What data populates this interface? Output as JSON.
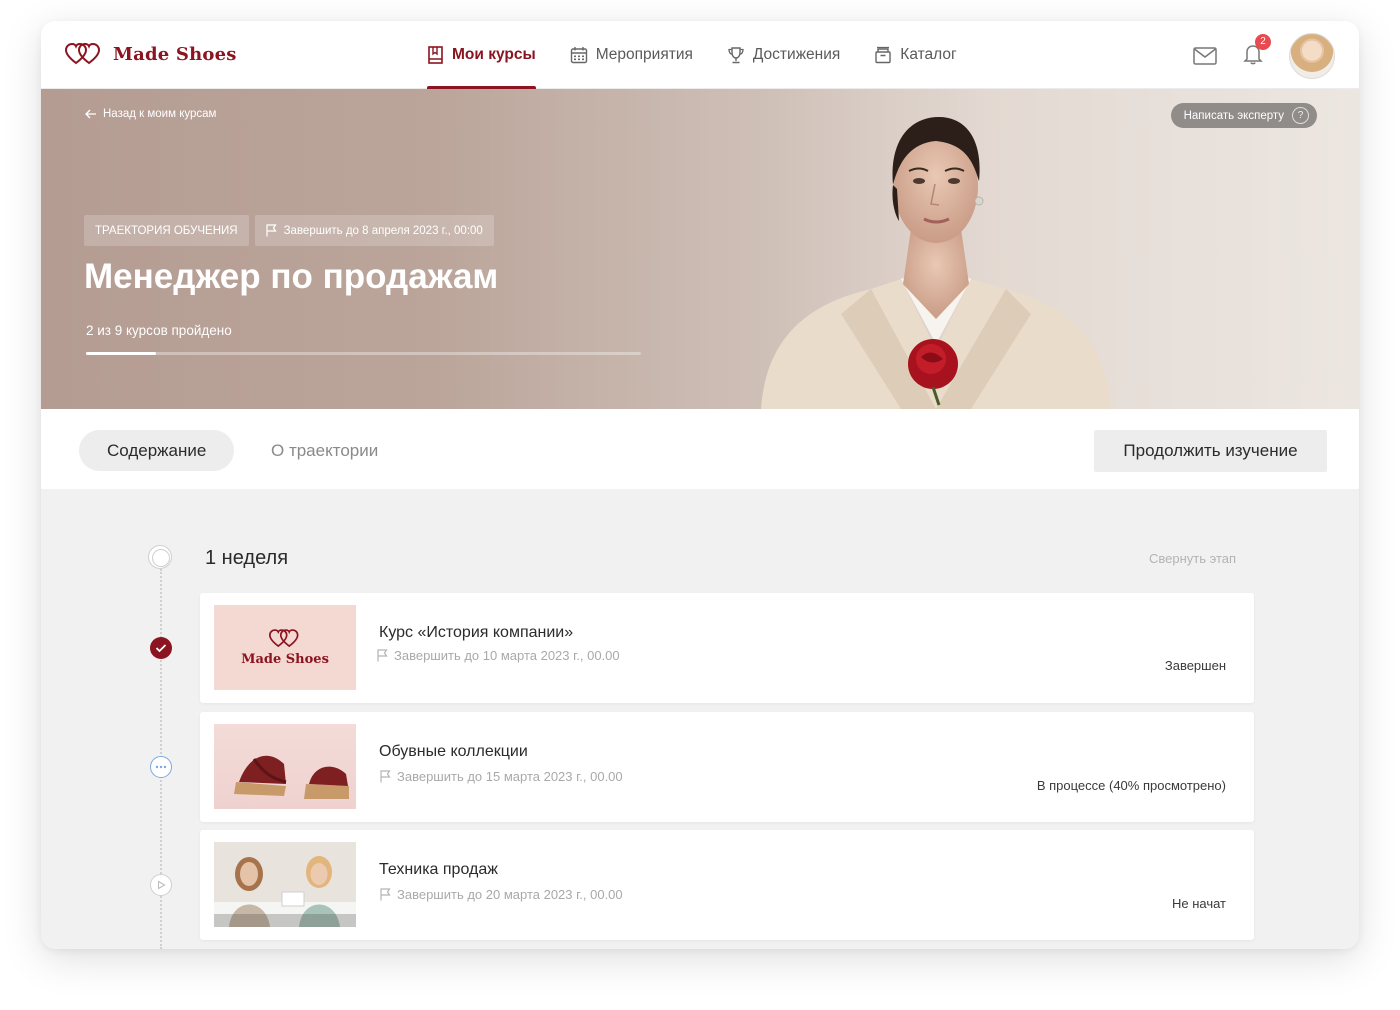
{
  "brand": {
    "name": "Made Shoes",
    "accent": "#8b1420"
  },
  "nav": {
    "items": [
      {
        "label": "Мои курсы",
        "icon": "book-icon",
        "active": true
      },
      {
        "label": "Мероприятия",
        "icon": "calendar-icon",
        "active": false
      },
      {
        "label": "Достижения",
        "icon": "trophy-icon",
        "active": false
      },
      {
        "label": "Каталог",
        "icon": "basket-icon",
        "active": false
      }
    ]
  },
  "header": {
    "notification_count": "2"
  },
  "hero": {
    "back_label": "Назад к моим курсам",
    "expert_button": "Написать эксперту",
    "help_glyph": "?",
    "tag_type": "ТРАЕКТОРИЯ ОБУЧЕНИЯ",
    "tag_deadline": "Завершить до 8 апреля 2023 г., 00:00",
    "title": "Менеджер по продажам",
    "progress_text": "2 из 9 курсов пройдено",
    "progress_fraction": 0.127
  },
  "tabs": {
    "content": "Содержание",
    "about": "О траектории",
    "continue_button": "Продолжить изучение"
  },
  "stage": {
    "title": "1 неделя",
    "collapse_label": "Свернуть этап",
    "courses": [
      {
        "title": "Курс «История компании»",
        "deadline": "Завершить до 10 марта 2023 г., 00.00",
        "status": "Завершен",
        "state": "done",
        "thumb_text": "Made Shoes"
      },
      {
        "title": "Обувные коллекции",
        "deadline": "Завершить до 15 марта 2023 г., 00.00",
        "status": "В процессе (40% просмотрено)",
        "state": "progress"
      },
      {
        "title": "Техника продаж",
        "deadline": "Завершить до 20 марта 2023 г., 00.00",
        "status": "Не начат",
        "state": "notstarted"
      }
    ]
  }
}
